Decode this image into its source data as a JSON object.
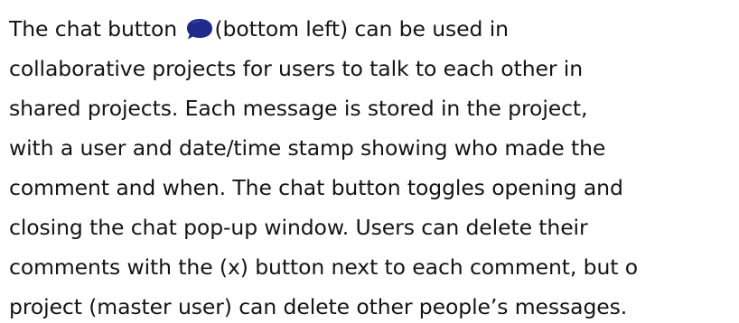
{
  "lines": [
    {
      "before": "The chat button ",
      "icon": "chat-bubble-icon",
      "after": "(bottom left) can be used in"
    },
    "collaborative projects for users to talk to each other in",
    "shared projects. Each message is stored in the project,",
    "with a user and date/time stamp showing who made the",
    "comment and when. The chat button toggles opening and",
    "closing the chat pop-up window. Users can delete their",
    "comments with the (x) button next to each comment, but o",
    "project (master user) can delete other people’s messages."
  ],
  "colors": {
    "text": "#141414",
    "chat_icon": "#1f2a8c"
  }
}
